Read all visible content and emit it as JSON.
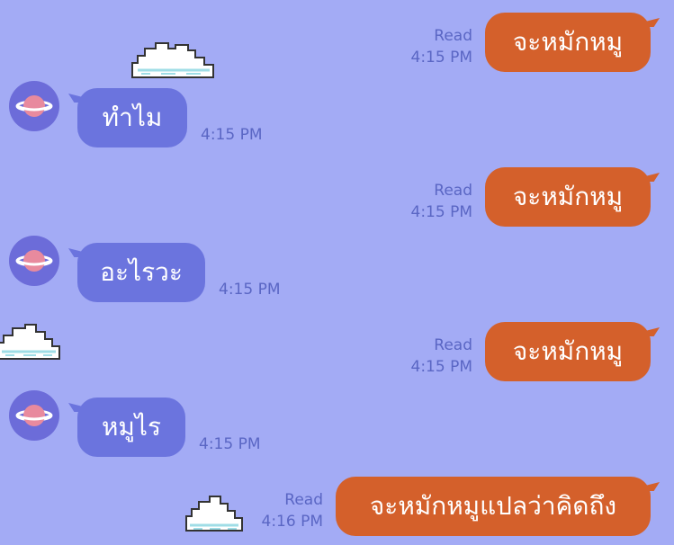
{
  "messages": [
    {
      "side": "out",
      "text": "จะหมักหมู",
      "read": "Read",
      "time": "4:15 PM"
    },
    {
      "side": "in",
      "text": "ทำไม",
      "time": "4:15 PM"
    },
    {
      "side": "out",
      "text": "จะหมักหมู",
      "read": "Read",
      "time": "4:15 PM"
    },
    {
      "side": "in",
      "text": "อะไรวะ",
      "time": "4:15 PM"
    },
    {
      "side": "out",
      "text": "จะหมักหมู",
      "read": "Read",
      "time": "4:15 PM"
    },
    {
      "side": "in",
      "text": "หมูไร",
      "time": "4:15 PM"
    },
    {
      "side": "out",
      "text": "จะหมักหมูแปลว่าคิดถึง",
      "read": "Read",
      "time": "4:16 PM"
    }
  ],
  "colors": {
    "background": "#a3abf5",
    "incoming_bubble": "#6b74de",
    "outgoing_bubble": "#d4602b",
    "meta_text": "#5a66c4",
    "avatar_bg": "#6c6cd9",
    "planet": "#e88a9e"
  },
  "icons": {
    "avatar": "planet-icon",
    "decoration": "pixel-cloud-icon"
  }
}
